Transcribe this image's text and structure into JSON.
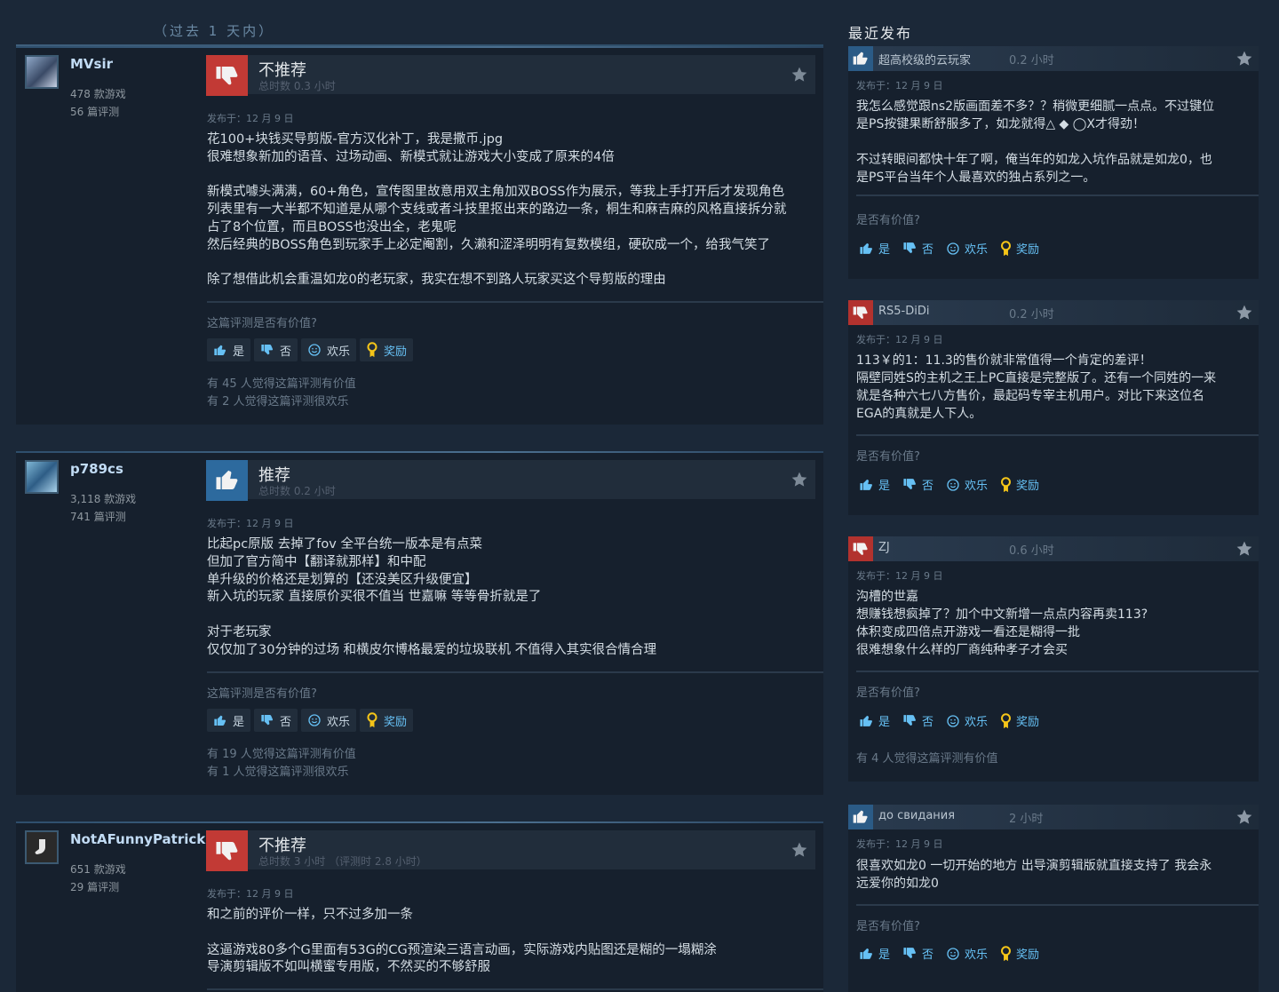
{
  "header": {
    "period": "（过去 1 天内）",
    "recent_title": "最近发布"
  },
  "reviews": [
    {
      "author": "MVsir",
      "games": "478 款游戏",
      "reviews_count": "56 篇评测",
      "verdict": "不推荐",
      "verdict_type": "down",
      "hours": "总时数 0.3 小时",
      "posted": "发布于：12 月 9 日",
      "lines": [
        "花100+块钱买导剪版-官方汉化补丁，我是撒币.jpg",
        "很难想象新加的语音、过场动画、新模式就让游戏大小变成了原来的4倍",
        "",
        "新模式噱头满满，60+角色，宣传图里故意用双主角加双BOSS作为展示，等我上手打开后才发现角色",
        "列表里有一大半都不知道是从哪个支线或者斗技里抠出来的路边一条，桐生和麻吉麻的风格直接拆分就",
        "占了8个位置，而且BOSS也没出全，老鬼呢",
        "然后经典的BOSS角色到玩家手上必定阉割，久濑和涩泽明明有复数模组，硬砍成一个，给我气笑了",
        "",
        "除了想借此机会重温如龙0的老玩家，我实在想不到路人玩家买这个导剪版的理由"
      ],
      "helpful_q": "这篇评测是否有价值?",
      "stats": [
        "有 45 人觉得这篇评测有价值",
        "有 2 人觉得这篇评测很欢乐"
      ]
    },
    {
      "author": "p789cs",
      "games": "3,118 款游戏",
      "reviews_count": "741 篇评测",
      "verdict": "推荐",
      "verdict_type": "up",
      "hours": "总时数 0.2 小时",
      "posted": "发布于：12 月 9 日",
      "lines": [
        "比起pc原版 去掉了fov 全平台统一版本是有点菜",
        "但加了官方简中【翻译就那样】和中配",
        "单升级的价格还是划算的【还没美区升级便宜】",
        "新入坑的玩家 直接原价买很不值当 世嘉嘛 等等骨折就是了",
        "",
        "对于老玩家",
        "仅仅加了30分钟的过场 和横皮尔博格最爱的垃圾联机 不值得入其实很合情合理"
      ],
      "helpful_q": "这篇评测是否有价值?",
      "stats": [
        "有 19 人觉得这篇评测有价值",
        "有 1 人觉得这篇评测很欢乐"
      ]
    },
    {
      "author": "NotAFunnyPatrickStar",
      "games": "651 款游戏",
      "reviews_count": "29 篇评测",
      "verdict": "不推荐",
      "verdict_type": "down",
      "hours": "总时数 3 小时 （评测时 2.8 小时）",
      "posted": "发布于：12 月 9 日",
      "lines": [
        "和之前的评价一样，只不过多加一条",
        "",
        "这逼游戏80多个G里面有53G的CG预渲染三语言动画，实际游戏内贴图还是糊的一塌糊涂",
        "导演剪辑版不如叫横蜜专用版，不然买的不够舒服"
      ]
    }
  ],
  "buttons": {
    "yes": "是",
    "no": "否",
    "funny": "欢乐",
    "award": "奖励"
  },
  "recent": [
    {
      "name": "超高校级的云玩家",
      "hours": "0.2 小时",
      "type": "up",
      "posted": "发布于：12 月 9 日",
      "lines": [
        "我怎么感觉跟ns2版画面差不多？？稍微更细腻一点点。不过键位",
        "是PS按键果断舒服多了，如龙就得△ ◆ ◯X才得劲！",
        "",
        "不过转眼间都快十年了啊，俺当年的如龙入坑作品就是如龙0，也",
        "是PS平台当年个人最喜欢的独占系列之一。"
      ],
      "helpful_q": "是否有价值?",
      "stats": ""
    },
    {
      "name": "RS5-DiDi",
      "hours": "0.2 小时",
      "type": "down",
      "posted": "发布于：12 月 9 日",
      "lines": [
        "113￥的1：11.3的售价就非常值得一个肯定的差评！",
        "隔壁同姓S的主机之王上PC直接是完整版了。还有一个同姓的一来",
        "就是各种六七八方售价，最起码专宰主机用户。对比下来这位名",
        "EGA的真就是人下人。"
      ],
      "helpful_q": "是否有价值?",
      "stats": ""
    },
    {
      "name": "ZJ",
      "hours": "0.6 小时",
      "type": "down",
      "posted": "发布于：12 月 9 日",
      "lines": [
        "沟槽的世嘉",
        "想赚钱想疯掉了？加个中文新增一点点内容再卖113?",
        "体积变成四倍点开游戏一看还是糊得一批",
        "很难想象什么样的厂商纯种孝子才会买"
      ],
      "helpful_q": "是否有价值?",
      "stats": "有 4 人觉得这篇评测有价值"
    },
    {
      "name": "до свидания",
      "hours": "2 小时",
      "type": "up",
      "posted": "发布于：12 月 9 日",
      "lines": [
        "很喜欢如龙0 一切开始的地方 出导演剪辑版就直接支持了 我会永",
        "远爱你的如龙0"
      ],
      "helpful_q": "是否有价值?",
      "stats": ""
    }
  ],
  "colors": {
    "background": "#1b2838",
    "recommend": "#2d6a9e",
    "not_recommend": "#c23a35",
    "link": "#66c0f4"
  }
}
